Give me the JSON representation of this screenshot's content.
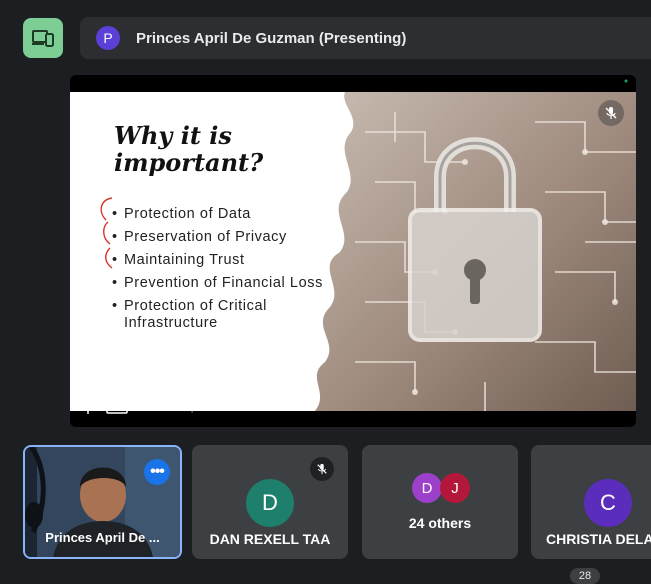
{
  "header": {
    "presenter_initial": "P",
    "presenter_banner": "Princes April De Guzman (Presenting)"
  },
  "slide": {
    "title_line1": "Why it is",
    "title_line2": "important?",
    "bullets": [
      "Protection of Data",
      "Preservation of Privacy",
      "Maintaining Trust",
      "Prevention of Financial Loss",
      "Protection of Critical Infrastructure"
    ]
  },
  "stage": {
    "presenter_name": "Princes April De Guzman"
  },
  "tiles": [
    {
      "name": "Princes April De ...",
      "self": true
    },
    {
      "name": "DAN REXELL TAA",
      "initial": "D",
      "color": "#1e7f6c",
      "muted": true
    },
    {
      "name": "24 others",
      "initials": [
        "D",
        "J"
      ],
      "colors": [
        "#9c3fc9",
        "#b3183a"
      ]
    },
    {
      "name": "CHRISTIA DELA",
      "initial": "C",
      "color": "#5b2dbd"
    }
  ],
  "participant_count": "28",
  "colors": {
    "accent_green": "#7dce94",
    "tile_bg": "#3c4043",
    "self_border": "#8ab4f8"
  }
}
